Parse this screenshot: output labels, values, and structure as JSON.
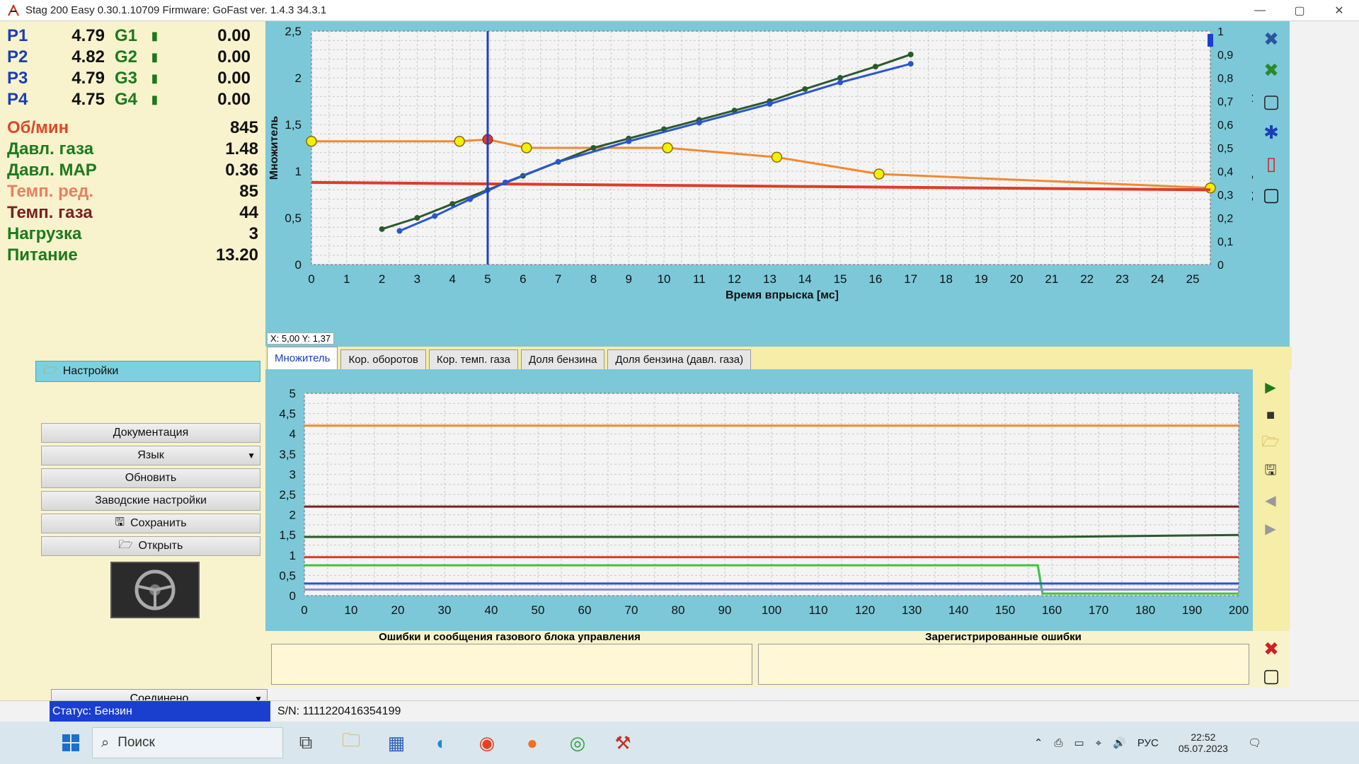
{
  "window": {
    "title": "Stag 200 Easy 0.30.1.10709 Firmware: GoFast  ver. 1.4.3  34.3.1",
    "minimize": "—",
    "maximize": "▢",
    "close": "✕"
  },
  "readings": [
    {
      "label": "P1",
      "value": "4.79",
      "glabel": "G1",
      "gvalue": "0.00"
    },
    {
      "label": "P2",
      "value": "4.82",
      "glabel": "G2",
      "gvalue": "0.00"
    },
    {
      "label": "P3",
      "value": "4.79",
      "glabel": "G3",
      "gvalue": "0.00"
    },
    {
      "label": "P4",
      "value": "4.75",
      "glabel": "G4",
      "gvalue": "0.00"
    }
  ],
  "stats": [
    {
      "label": "Об/мин",
      "value": "845",
      "color": "#e0462b"
    },
    {
      "label": "Давл. газа",
      "value": "1.48",
      "color": "#1c7a1c"
    },
    {
      "label": "Давл. MAP",
      "value": "0.36",
      "color": "#1c7a1c"
    },
    {
      "label": "Темп. ред.",
      "value": "85",
      "color": "#e88060"
    },
    {
      "label": "Темп. газа",
      "value": "44",
      "color": "#7a2020"
    },
    {
      "label": "Нагрузка",
      "value": "3",
      "color": "#1c7a1c"
    },
    {
      "label": "Питание",
      "value": "13.20",
      "color": "#1c7a1c"
    }
  ],
  "settings_header": "Настройки",
  "menu": {
    "documentation": "Документация",
    "language": "Язык",
    "refresh": "Обновить",
    "factory": "Заводские настройки",
    "save": "Сохранить",
    "open": "Открыть"
  },
  "connection": "Соединено",
  "top_chart": {
    "coord_readout": "X: 5,00  Y: 1,37"
  },
  "tabs": [
    "Множитель",
    "Кор. оборотов",
    "Кор. темп. газа",
    "Доля бензина",
    "Доля бензина (давл. газа)"
  ],
  "errors": {
    "left_title": "Ошибки и сообщения газового блока управления",
    "right_title": "Зарегистрированные ошибки"
  },
  "status": {
    "mode": "Статус: Бензин",
    "serial": "S/N: 1111220416354199"
  },
  "taskbar": {
    "search": "Поиск",
    "lang": "РУС",
    "time": "22:52",
    "date": "05.07.2023"
  },
  "colors": {
    "panel_teal": "#7cc8d8",
    "panel_yellow": "#f8f3cd",
    "status_blue": "#1a3fcf"
  },
  "chart_data": [
    {
      "type": "line",
      "xlabel": "Время впрыска [мс]",
      "ylabel": "Множитель",
      "y2label": "Давление MAP [бар]",
      "xlim": [
        0,
        25.5
      ],
      "ylim": [
        0,
        2.5
      ],
      "y2lim": [
        0,
        1
      ],
      "xticks": [
        "0",
        "1",
        "2",
        "3",
        "4",
        "5",
        "6",
        "7",
        "8",
        "9",
        "10",
        "11",
        "12",
        "13",
        "14",
        "15",
        "16",
        "17",
        "18",
        "19",
        "20",
        "21",
        "22",
        "23",
        "24",
        "25"
      ],
      "yticks": [
        "0",
        "0,5",
        "1",
        "1,5",
        "2",
        "2,5"
      ],
      "y2ticks": [
        "0",
        "0,1",
        "0,2",
        "0,3",
        "0,4",
        "0,5",
        "0,6",
        "0,7",
        "0,8",
        "0,9",
        "1"
      ],
      "grid": true,
      "cursor_x": 5.0,
      "series": [
        {
          "color": "#f08a30",
          "x": [
            0,
            4.2,
            5.0,
            6.1,
            10.1,
            13.2,
            16.1,
            25.5
          ],
          "y": [
            1.32,
            1.32,
            1.34,
            1.25,
            1.25,
            1.15,
            0.97,
            0.82
          ],
          "markers_yellow": [
            0,
            4.2,
            6.1,
            10.1,
            13.2,
            16.1,
            25.5
          ],
          "marker_red": 5.0
        },
        {
          "color": "#e03a2a",
          "x": [
            0,
            25.5
          ],
          "y": [
            0.88,
            0.8
          ]
        },
        {
          "color": "#2a5a2a",
          "x": [
            2.0,
            3.0,
            4.0,
            5.0,
            6.0,
            7.0,
            8.0,
            9.0,
            10.0,
            11.0,
            12.0,
            13.0,
            14.0,
            15.0,
            16.0,
            17.0
          ],
          "y": [
            0.38,
            0.5,
            0.65,
            0.8,
            0.95,
            1.1,
            1.25,
            1.35,
            1.45,
            1.55,
            1.65,
            1.75,
            1.88,
            2.0,
            2.12,
            2.25
          ]
        },
        {
          "color": "#2a55d0",
          "x": [
            2.5,
            3.5,
            4.5,
            5.5,
            7.0,
            9.0,
            11.0,
            13.0,
            15.0,
            17.0
          ],
          "y": [
            0.36,
            0.52,
            0.7,
            0.88,
            1.1,
            1.32,
            1.52,
            1.72,
            1.95,
            2.15
          ]
        }
      ]
    },
    {
      "type": "line",
      "xlim": [
        0,
        200
      ],
      "ylim": [
        0,
        5
      ],
      "xticks": [
        "0",
        "10",
        "20",
        "30",
        "40",
        "50",
        "60",
        "70",
        "80",
        "90",
        "100",
        "110",
        "120",
        "130",
        "140",
        "150",
        "160",
        "170",
        "180",
        "190",
        "200"
      ],
      "yticks": [
        "0",
        "0,5",
        "1",
        "1,5",
        "2",
        "2,5",
        "3",
        "3,5",
        "4",
        "4,5",
        "5"
      ],
      "grid": true,
      "series": [
        {
          "color": "#f08a30",
          "x": [
            0,
            200
          ],
          "y": [
            4.2,
            4.2
          ]
        },
        {
          "color": "#7a2020",
          "x": [
            0,
            200
          ],
          "y": [
            2.2,
            2.2
          ]
        },
        {
          "color": "#2a5a2a",
          "x": [
            0,
            160,
            200
          ],
          "y": [
            1.45,
            1.45,
            1.5
          ]
        },
        {
          "color": "#e03a2a",
          "x": [
            0,
            200
          ],
          "y": [
            0.95,
            0.95
          ]
        },
        {
          "color": "#3cc43c",
          "x": [
            0,
            157,
            158,
            200
          ],
          "y": [
            0.75,
            0.75,
            0.05,
            0.05
          ]
        },
        {
          "color": "#2a55d0",
          "x": [
            0,
            200
          ],
          "y": [
            0.3,
            0.3
          ]
        },
        {
          "color": "#8a8ae0",
          "x": [
            0,
            200
          ],
          "y": [
            0.15,
            0.15
          ]
        }
      ]
    }
  ]
}
